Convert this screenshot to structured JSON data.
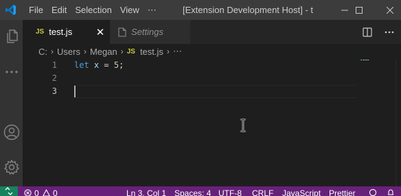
{
  "titlebar": {
    "menu": [
      "File",
      "Edit",
      "Selection",
      "View",
      "⋯"
    ],
    "window_title": "[Extension Development Host] - t..."
  },
  "tabs": [
    {
      "badge": "JS",
      "label": "test.js",
      "active": true,
      "close": "✕"
    },
    {
      "label": "Settings",
      "active": false
    }
  ],
  "breadcrumb": {
    "segments": [
      "C:",
      "Users",
      "Megan"
    ],
    "file_badge": "JS",
    "file": "test.js",
    "separator": "›"
  },
  "editor": {
    "line_numbers": [
      "1",
      "2",
      "3"
    ],
    "line1": {
      "keyword": "let",
      "variable": "x",
      "operator": "=",
      "number": "5",
      "terminator": ";"
    }
  },
  "statusbar": {
    "errors": "0",
    "warnings": "0",
    "position": "Ln 3, Col 1",
    "spaces": "Spaces: 4",
    "encoding": "UTF-8",
    "eol": "CRLF",
    "language": "JavaScript",
    "formatter": "Prettier"
  },
  "icons": {
    "logo": "vscode-logo-icon",
    "explorer": "files-icon",
    "more": "ellipsis-icon",
    "account": "account-icon",
    "manage": "gear-icon",
    "settings_tab": "file-icon",
    "split": "split-editor-icon",
    "remote": "remote-icon",
    "error": "error-icon",
    "warning": "warning-icon",
    "feedback": "feedback-icon",
    "notifications": "bell-icon"
  },
  "colors": {
    "titlebar": "#3c3c3c",
    "activitybar": "#333333",
    "editor_bg": "#1e1e1e",
    "statusbar": "#68217a",
    "remote": "#16825d",
    "js_badge": "#cbcb41",
    "keyword": "#569cd6",
    "variable": "#9cdcfe",
    "number": "#b5cea8",
    "logo": "#007acc"
  }
}
